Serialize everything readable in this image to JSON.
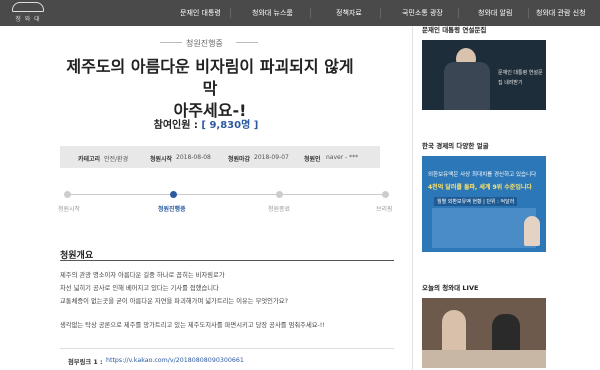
{
  "header": {
    "logo_text": "청 와 대",
    "nav": [
      "문재인 대통령",
      "청와대 뉴스룸",
      "정책자료",
      "국민소통 광장",
      "청와대 알림",
      "청와대 관람 신청"
    ]
  },
  "petition": {
    "status_tag": "청원진행중",
    "title_line1": "제주도의 아름다운 비자림이 파괴되지 않게 막",
    "title_line2": "아주세요-!",
    "count_prefix": "참여인원 : ",
    "count_value": "[ 9,830명 ]",
    "info": {
      "category_label": "카테고리",
      "category_value": "안전/환경",
      "start_label": "청원시작",
      "start_value": "2018-08-08",
      "end_label": "청원마감",
      "end_value": "2018-09-07",
      "author_label": "청원인",
      "author_value": "naver - ***"
    },
    "steps": [
      "청원시작",
      "청원진행중",
      "청원종료",
      "브리핑"
    ],
    "section_title": "청원개요",
    "body": [
      "제주의 관광 명소이자 아름다운 길중 하나로 꼽히는 비자림로가",
      "차선 넓히기 공사로 인해 베어지고 있다는 기사를 접했습니다",
      "교통체증이 없는곳을 굳이 아름다운 자연을 파괴해가며 넓가트리는 이유는 무엇인가요?",
      "생각없는 탁상 공론으로 제주를 망가트리고 있는 제주도지사를 파면시키고 당장 공사를 멈춰주세요-!!"
    ],
    "link_label": "첨부링크 1 :",
    "link_url": "https://v.kakao.com/v/20180808090300661"
  },
  "sidebar": {
    "section1_title": "문재인 대통령 연설문집",
    "section1_caption": "문재인 대통령 연설문집 내려받기",
    "section2_title": "한국 경제의 다양한 얼굴",
    "section2_line1": "외환보유액은 사상 최대치를 경신하고 있습니다",
    "section2_line2": "4천억 달러를 돌파, 세계 9위 수준입니다",
    "section2_line3": "월별 외환보유액 현황 | 단위 : 억달러",
    "section3_title": "오늘의 청와대 LIVE"
  },
  "colors": {
    "nav_bg": "#4a4a4a",
    "accent": "#2c5aa0",
    "info_bg": "#e8e8e8"
  }
}
